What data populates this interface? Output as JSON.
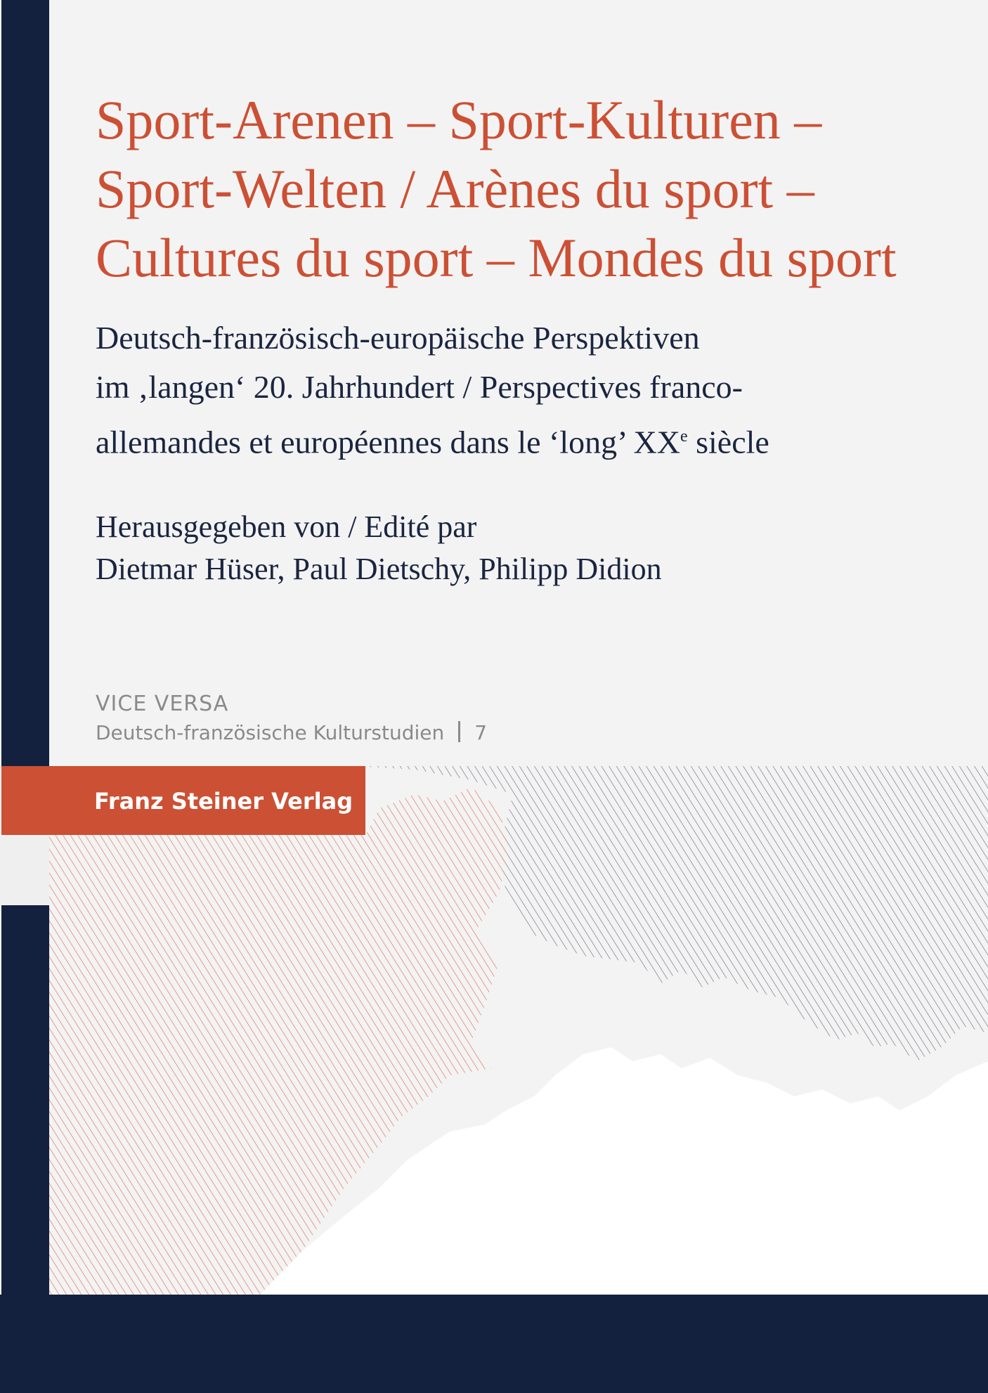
{
  "cover": {
    "title_lines": [
      "Sport-Arenen – Sport-Kulturen –",
      "Sport-Welten / Arènes du sport –",
      "Cultures du sport – Mondes du sport"
    ],
    "subtitle_lines": [
      "Deutsch-französisch-europäische Perspektiven",
      "im ‚langen‘ 20. Jahrhundert / Perspectives franco-",
      "allemandes et européennes dans le ‘long’ XX",
      "e",
      " siècle"
    ],
    "editors_label": "Herausgegeben von / Edité par",
    "editors": "Dietmar Hüser, Paul Dietschy, Philipp Didion",
    "series": {
      "name": "VICE VERSA",
      "subtitle": "Deutsch-französische Kulturstudien",
      "number": "7"
    },
    "publisher": "Franz Steiner Verlag",
    "colors": {
      "accent": "#cc5034",
      "navy": "#13213e",
      "background": "#f3f3f3",
      "gray_text": "#8a8a8a"
    }
  }
}
